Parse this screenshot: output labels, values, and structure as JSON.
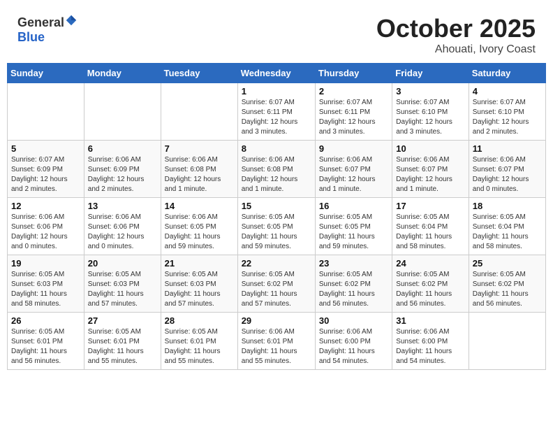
{
  "header": {
    "logo_general": "General",
    "logo_blue": "Blue",
    "month": "October 2025",
    "location": "Ahouati, Ivory Coast"
  },
  "weekdays": [
    "Sunday",
    "Monday",
    "Tuesday",
    "Wednesday",
    "Thursday",
    "Friday",
    "Saturday"
  ],
  "weeks": [
    [
      {
        "day": "",
        "info": ""
      },
      {
        "day": "",
        "info": ""
      },
      {
        "day": "",
        "info": ""
      },
      {
        "day": "1",
        "info": "Sunrise: 6:07 AM\nSunset: 6:11 PM\nDaylight: 12 hours\nand 3 minutes."
      },
      {
        "day": "2",
        "info": "Sunrise: 6:07 AM\nSunset: 6:11 PM\nDaylight: 12 hours\nand 3 minutes."
      },
      {
        "day": "3",
        "info": "Sunrise: 6:07 AM\nSunset: 6:10 PM\nDaylight: 12 hours\nand 3 minutes."
      },
      {
        "day": "4",
        "info": "Sunrise: 6:07 AM\nSunset: 6:10 PM\nDaylight: 12 hours\nand 2 minutes."
      }
    ],
    [
      {
        "day": "5",
        "info": "Sunrise: 6:07 AM\nSunset: 6:09 PM\nDaylight: 12 hours\nand 2 minutes."
      },
      {
        "day": "6",
        "info": "Sunrise: 6:06 AM\nSunset: 6:09 PM\nDaylight: 12 hours\nand 2 minutes."
      },
      {
        "day": "7",
        "info": "Sunrise: 6:06 AM\nSunset: 6:08 PM\nDaylight: 12 hours\nand 1 minute."
      },
      {
        "day": "8",
        "info": "Sunrise: 6:06 AM\nSunset: 6:08 PM\nDaylight: 12 hours\nand 1 minute."
      },
      {
        "day": "9",
        "info": "Sunrise: 6:06 AM\nSunset: 6:07 PM\nDaylight: 12 hours\nand 1 minute."
      },
      {
        "day": "10",
        "info": "Sunrise: 6:06 AM\nSunset: 6:07 PM\nDaylight: 12 hours\nand 1 minute."
      },
      {
        "day": "11",
        "info": "Sunrise: 6:06 AM\nSunset: 6:07 PM\nDaylight: 12 hours\nand 0 minutes."
      }
    ],
    [
      {
        "day": "12",
        "info": "Sunrise: 6:06 AM\nSunset: 6:06 PM\nDaylight: 12 hours\nand 0 minutes."
      },
      {
        "day": "13",
        "info": "Sunrise: 6:06 AM\nSunset: 6:06 PM\nDaylight: 12 hours\nand 0 minutes."
      },
      {
        "day": "14",
        "info": "Sunrise: 6:06 AM\nSunset: 6:05 PM\nDaylight: 11 hours\nand 59 minutes."
      },
      {
        "day": "15",
        "info": "Sunrise: 6:05 AM\nSunset: 6:05 PM\nDaylight: 11 hours\nand 59 minutes."
      },
      {
        "day": "16",
        "info": "Sunrise: 6:05 AM\nSunset: 6:05 PM\nDaylight: 11 hours\nand 59 minutes."
      },
      {
        "day": "17",
        "info": "Sunrise: 6:05 AM\nSunset: 6:04 PM\nDaylight: 11 hours\nand 58 minutes."
      },
      {
        "day": "18",
        "info": "Sunrise: 6:05 AM\nSunset: 6:04 PM\nDaylight: 11 hours\nand 58 minutes."
      }
    ],
    [
      {
        "day": "19",
        "info": "Sunrise: 6:05 AM\nSunset: 6:03 PM\nDaylight: 11 hours\nand 58 minutes."
      },
      {
        "day": "20",
        "info": "Sunrise: 6:05 AM\nSunset: 6:03 PM\nDaylight: 11 hours\nand 57 minutes."
      },
      {
        "day": "21",
        "info": "Sunrise: 6:05 AM\nSunset: 6:03 PM\nDaylight: 11 hours\nand 57 minutes."
      },
      {
        "day": "22",
        "info": "Sunrise: 6:05 AM\nSunset: 6:02 PM\nDaylight: 11 hours\nand 57 minutes."
      },
      {
        "day": "23",
        "info": "Sunrise: 6:05 AM\nSunset: 6:02 PM\nDaylight: 11 hours\nand 56 minutes."
      },
      {
        "day": "24",
        "info": "Sunrise: 6:05 AM\nSunset: 6:02 PM\nDaylight: 11 hours\nand 56 minutes."
      },
      {
        "day": "25",
        "info": "Sunrise: 6:05 AM\nSunset: 6:02 PM\nDaylight: 11 hours\nand 56 minutes."
      }
    ],
    [
      {
        "day": "26",
        "info": "Sunrise: 6:05 AM\nSunset: 6:01 PM\nDaylight: 11 hours\nand 56 minutes."
      },
      {
        "day": "27",
        "info": "Sunrise: 6:05 AM\nSunset: 6:01 PM\nDaylight: 11 hours\nand 55 minutes."
      },
      {
        "day": "28",
        "info": "Sunrise: 6:05 AM\nSunset: 6:01 PM\nDaylight: 11 hours\nand 55 minutes."
      },
      {
        "day": "29",
        "info": "Sunrise: 6:06 AM\nSunset: 6:01 PM\nDaylight: 11 hours\nand 55 minutes."
      },
      {
        "day": "30",
        "info": "Sunrise: 6:06 AM\nSunset: 6:00 PM\nDaylight: 11 hours\nand 54 minutes."
      },
      {
        "day": "31",
        "info": "Sunrise: 6:06 AM\nSunset: 6:00 PM\nDaylight: 11 hours\nand 54 minutes."
      },
      {
        "day": "",
        "info": ""
      }
    ]
  ]
}
